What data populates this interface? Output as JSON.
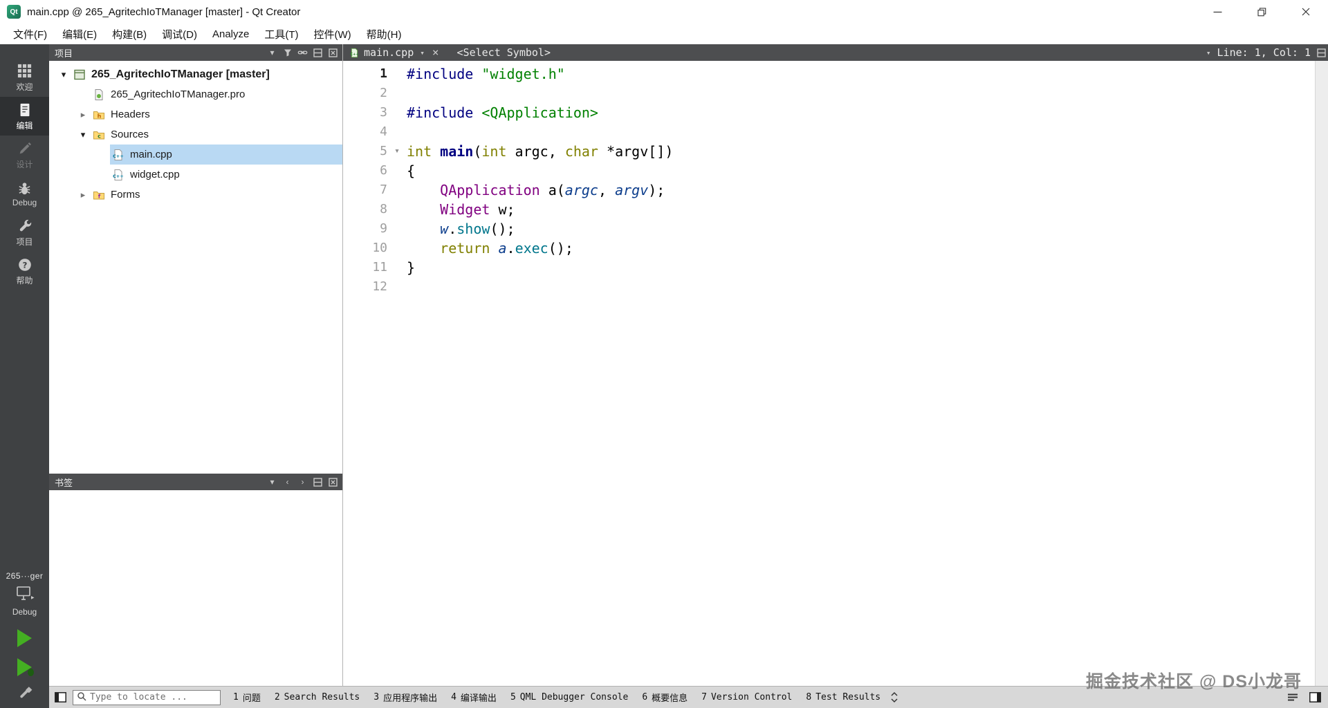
{
  "window": {
    "title": "main.cpp @ 265_AgritechIoTManager [master] - Qt Creator",
    "app_badge": "Qt"
  },
  "menu": {
    "items": [
      "文件(F)",
      "编辑(E)",
      "构建(B)",
      "调试(D)",
      "Analyze",
      "工具(T)",
      "控件(W)",
      "帮助(H)"
    ]
  },
  "mode_bar": {
    "items": [
      {
        "label": "欢迎",
        "icon": "grid",
        "state": "normal"
      },
      {
        "label": "编辑",
        "icon": "edit",
        "state": "selected"
      },
      {
        "label": "设计",
        "icon": "design",
        "state": "disabled"
      },
      {
        "label": "Debug",
        "icon": "bug",
        "state": "normal"
      },
      {
        "label": "项目",
        "icon": "wrench",
        "state": "normal"
      },
      {
        "label": "帮助",
        "icon": "help",
        "state": "normal"
      }
    ],
    "kit_name": "265···ger",
    "kit_config": "Debug"
  },
  "projects_pane": {
    "title": "项目",
    "tree": [
      {
        "label": "265_AgritechIoTManager [master]",
        "level": 0,
        "icon": "project",
        "expand": "open",
        "bold": true
      },
      {
        "label": "265_AgritechIoTManager.pro",
        "level": 1,
        "icon": "profile",
        "expand": "none"
      },
      {
        "label": "Headers",
        "level": 1,
        "icon": "folder-h",
        "expand": "closed"
      },
      {
        "label": "Sources",
        "level": 1,
        "icon": "folder-c",
        "expand": "open"
      },
      {
        "label": "main.cpp",
        "level": 2,
        "icon": "cpp",
        "expand": "none",
        "selected": true
      },
      {
        "label": "widget.cpp",
        "level": 2,
        "icon": "cpp",
        "expand": "none"
      },
      {
        "label": "Forms",
        "level": 1,
        "icon": "folder-f",
        "expand": "closed"
      }
    ]
  },
  "bookmarks_pane": {
    "title": "书签"
  },
  "editor": {
    "open_file": "main.cpp",
    "symbol_selector": "<Select Symbol>",
    "cursor_position": "Line: 1, Col: 1",
    "code_lines": [
      {
        "n": 1,
        "tokens": [
          {
            "t": "#include ",
            "c": "pp"
          },
          {
            "t": "\"widget.h\"",
            "c": "str"
          }
        ]
      },
      {
        "n": 2,
        "tokens": []
      },
      {
        "n": 3,
        "tokens": [
          {
            "t": "#include ",
            "c": "pp"
          },
          {
            "t": "<QApplication>",
            "c": "str"
          }
        ]
      },
      {
        "n": 4,
        "tokens": []
      },
      {
        "n": 5,
        "fold": "open",
        "tokens": [
          {
            "t": "int",
            "c": "kw"
          },
          {
            "t": " "
          },
          {
            "t": "main",
            "c": "fnb"
          },
          {
            "t": "("
          },
          {
            "t": "int",
            "c": "kw"
          },
          {
            "t": " argc, "
          },
          {
            "t": "char",
            "c": "kw"
          },
          {
            "t": " *argv[])"
          }
        ]
      },
      {
        "n": 6,
        "tokens": [
          {
            "t": "{"
          }
        ]
      },
      {
        "n": 7,
        "tokens": [
          {
            "t": "    "
          },
          {
            "t": "QApplication",
            "c": "ty"
          },
          {
            "t": " a("
          },
          {
            "t": "argc",
            "c": "loci"
          },
          {
            "t": ", "
          },
          {
            "t": "argv",
            "c": "loci"
          },
          {
            "t": ");"
          }
        ]
      },
      {
        "n": 8,
        "tokens": [
          {
            "t": "    "
          },
          {
            "t": "Widget",
            "c": "ty"
          },
          {
            "t": " w;"
          }
        ]
      },
      {
        "n": 9,
        "tokens": [
          {
            "t": "    "
          },
          {
            "t": "w",
            "c": "loci"
          },
          {
            "t": "."
          },
          {
            "t": "show",
            "c": "fn"
          },
          {
            "t": "();"
          }
        ]
      },
      {
        "n": 10,
        "tokens": [
          {
            "t": "    "
          },
          {
            "t": "return",
            "c": "kw"
          },
          {
            "t": " "
          },
          {
            "t": "a",
            "c": "loci"
          },
          {
            "t": "."
          },
          {
            "t": "exec",
            "c": "fn"
          },
          {
            "t": "();"
          }
        ]
      },
      {
        "n": 11,
        "tokens": [
          {
            "t": "}"
          }
        ]
      },
      {
        "n": 12,
        "tokens": []
      }
    ]
  },
  "status_bar": {
    "locator_placeholder": "Type to locate ...",
    "output_panes": [
      {
        "num": "1",
        "label": "问题"
      },
      {
        "num": "2",
        "label": "Search Results"
      },
      {
        "num": "3",
        "label": "应用程序输出"
      },
      {
        "num": "4",
        "label": "编译输出"
      },
      {
        "num": "5",
        "label": "QML Debugger Console"
      },
      {
        "num": "6",
        "label": "概要信息"
      },
      {
        "num": "7",
        "label": "Version Control"
      },
      {
        "num": "8",
        "label": "Test Results"
      }
    ]
  },
  "watermark": "掘金技术社区 @ DS小龙哥"
}
